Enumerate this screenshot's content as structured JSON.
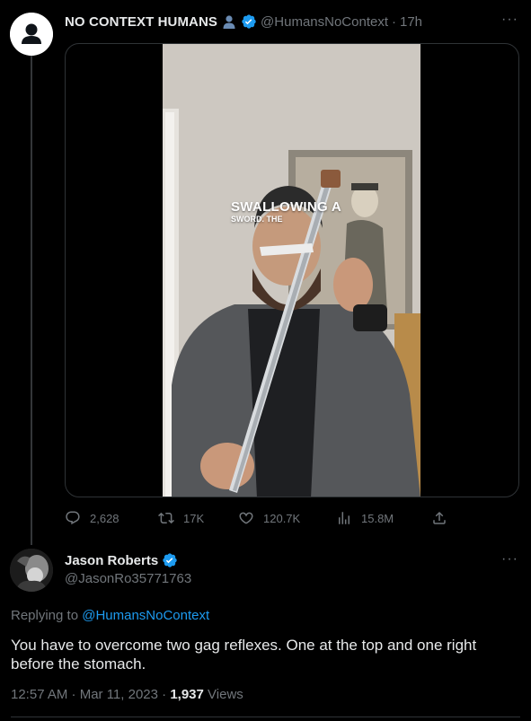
{
  "original_tweet": {
    "author_name": "NO CONTEXT HUMANS",
    "author_handle": "@HumansNoContext",
    "separator": "·",
    "time": "17h",
    "more": "···",
    "video_caption_line1": "SWALLOWING A",
    "video_caption_line2": "SWORD. THE",
    "stats": {
      "replies": "2,628",
      "retweets": "17K",
      "likes": "120.7K",
      "views": "15.8M"
    }
  },
  "reply_tweet": {
    "author_name": "Jason Roberts",
    "author_handle": "@JasonRo35771763",
    "more": "···",
    "replying_prefix": "Replying to",
    "replying_to": "@HumansNoContext",
    "text": "You have to overcome two gag reflexes. One at the top and one right before the stomach.",
    "timestamp": "12:57 AM · Mar 11, 2023 ·",
    "views_count": "1,937",
    "views_label": "Views"
  },
  "icons": {
    "avatar_default": "default-avatar-icon",
    "verified": "verified-badge-icon",
    "person_emoji": "person-silhouette-icon",
    "reply": "reply-icon",
    "retweet": "retweet-icon",
    "like": "heart-icon",
    "views": "views-chart-icon",
    "share": "share-icon"
  },
  "colors": {
    "background": "#000000",
    "text_primary": "#e7e9ea",
    "text_secondary": "#71767b",
    "accent": "#1d9bf0",
    "border": "#2f3336"
  }
}
